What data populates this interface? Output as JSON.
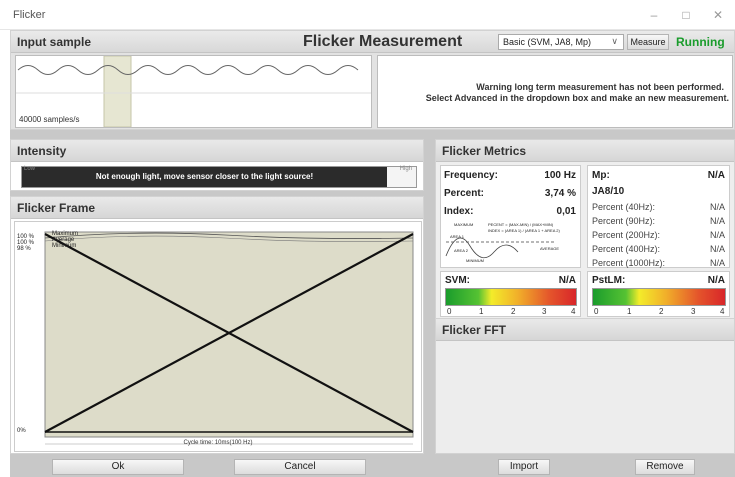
{
  "window": {
    "title": "Flicker"
  },
  "header": {
    "input_sample_title": "Input sample",
    "main_title": "Flicker Measurement",
    "mode_selected": "Basic (SVM, JA8, Mp)",
    "measure_label": "Measure",
    "status": "Running",
    "status_color": "#1a9c2c"
  },
  "input_sample": {
    "samples_label": "40000 samples/s",
    "warning_line1": "Warning long term measurement has not been performed.",
    "warning_line2": "Select Advanced in the dropdown box and make an new measurement."
  },
  "intensity": {
    "title": "Intensity",
    "low_label": "Low",
    "high_label": "High",
    "message": "Not enough light, move sensor closer to the light source!"
  },
  "flicker_frame": {
    "title": "Flicker Frame",
    "y_labels": [
      "100 %",
      "100 %",
      "98 %",
      "0%"
    ],
    "legend": [
      "Maximum",
      "Average",
      "Minimum"
    ],
    "cycle_label": "Cycle time: 10ms(100 Hz)"
  },
  "metrics": {
    "title": "Flicker Metrics",
    "frequency_label": "Frequency:",
    "frequency_value": "100 Hz",
    "percent_label": "Percent:",
    "percent_value": "3,74 %",
    "index_label": "Index:",
    "index_value": "0,01",
    "mp_label": "Mp:",
    "mp_value": "N/A",
    "ja8_label": "JA8/10",
    "percents": [
      {
        "label": "Percent (40Hz):",
        "value": "N/A"
      },
      {
        "label": "Percent (90Hz):",
        "value": "N/A"
      },
      {
        "label": "Percent (200Hz):",
        "value": "N/A"
      },
      {
        "label": "Percent (400Hz):",
        "value": "N/A"
      },
      {
        "label": "Percent (1000Hz):",
        "value": "N/A"
      }
    ],
    "svm_label": "SVM:",
    "svm_value": "N/A",
    "pstlm_label": "PstLM:",
    "pstlm_value": "N/A",
    "scale_ticks": [
      "0",
      "1",
      "2",
      "3",
      "4"
    ],
    "diagram": {
      "maximum": "MAXIMUM",
      "percent_formula": "PECENT = (MAX-MIN) / (MAX+MIN)",
      "index_formula": "INDEX = (AREA 1) / (AREA 1 + AREA 2)",
      "area1": "AREA 1",
      "area2": "AREA 2",
      "minimum": "MINIMUM",
      "average": "AVERAGE"
    }
  },
  "fft": {
    "title": "Flicker FFT"
  },
  "buttons": {
    "ok": "Ok",
    "cancel": "Cancel",
    "import": "Import",
    "remove": "Remove"
  }
}
